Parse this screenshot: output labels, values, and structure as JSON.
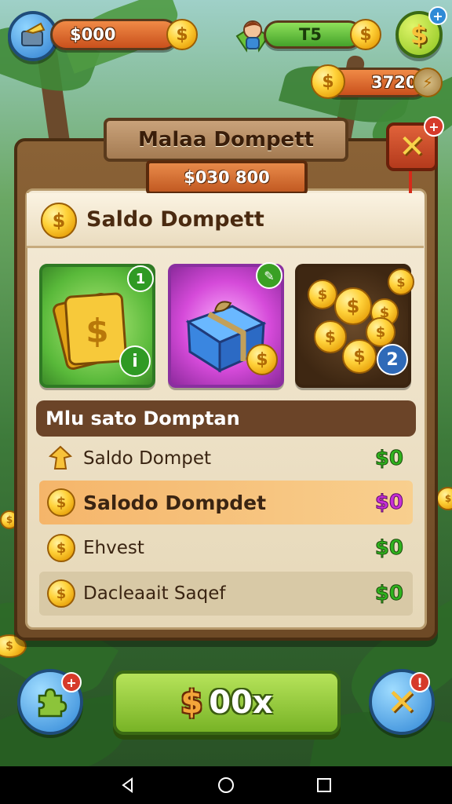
{
  "hud": {
    "wallet_value": "$000",
    "energy_value": "T5",
    "coins_value": "3720"
  },
  "panel": {
    "title": "Malaa Dompett",
    "subtitle": "$030 800",
    "balance_label": "Saldo Dompett"
  },
  "cards": [
    {
      "name": "cash-card",
      "badge": "1",
      "corner_badge": "i"
    },
    {
      "name": "gift-box-card",
      "badge": "✎"
    },
    {
      "name": "coin-pile-card",
      "badge": "2"
    }
  ],
  "section": {
    "title": "Mlu sato Domptan"
  },
  "list": [
    {
      "label": "Saldo Dompet",
      "value": "$0",
      "value_color": "#2fb31e",
      "icon": "gem-icon",
      "highlight": false
    },
    {
      "label": "Salodo Dompdet",
      "value": "$0",
      "value_color": "#c82fd6",
      "icon": "coin-icon",
      "highlight": true
    },
    {
      "label": "Ehvest",
      "value": "$0",
      "value_color": "#2fb31e",
      "icon": "coin-icon",
      "highlight": false
    },
    {
      "label": "Dacleaait Saqef",
      "value": "$0",
      "value_color": "#2fb31e",
      "icon": "coin-icon",
      "highlight": false
    }
  ],
  "bottom": {
    "action_glyph": "$",
    "action_label": "00x"
  },
  "colors": {
    "accent_green": "#78b326",
    "panel_brown": "#6e4a26",
    "coin_gold": "#ffd23a",
    "highlight_orange": "#f5c07a"
  }
}
